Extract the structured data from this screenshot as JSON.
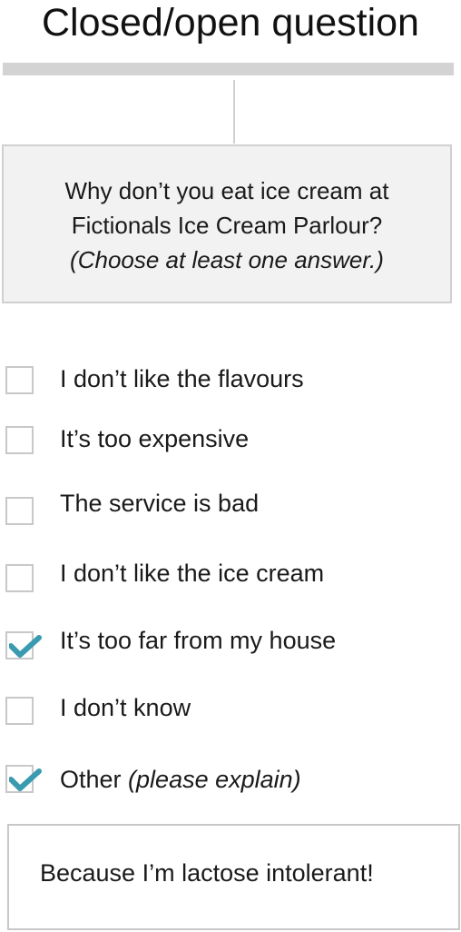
{
  "title": "Closed/open question",
  "question": {
    "line1": "Why don’t you eat ice cream at",
    "line2": "Fictionals Ice Cream Parlour?",
    "hint": "(Choose at least one answer.)"
  },
  "options": [
    {
      "label": "I don’t like the flavours",
      "checked": false
    },
    {
      "label": "It’s too expensive",
      "checked": false
    },
    {
      "label": "The service is bad",
      "checked": false
    },
    {
      "label": "I don’t like the ice cream",
      "checked": false
    },
    {
      "label": "It’s too far from my house",
      "checked": true
    },
    {
      "label": "I don’t know",
      "checked": false
    },
    {
      "label": "Other",
      "hint": "(please explain)",
      "checked": true
    }
  ],
  "answer": {
    "value": "Because I’m lactose intolerant!"
  },
  "colors": {
    "check": "#3a9bb0",
    "border": "#c8c8c8",
    "question_bg": "#f2f2f2",
    "rule": "#d3d3d3"
  }
}
